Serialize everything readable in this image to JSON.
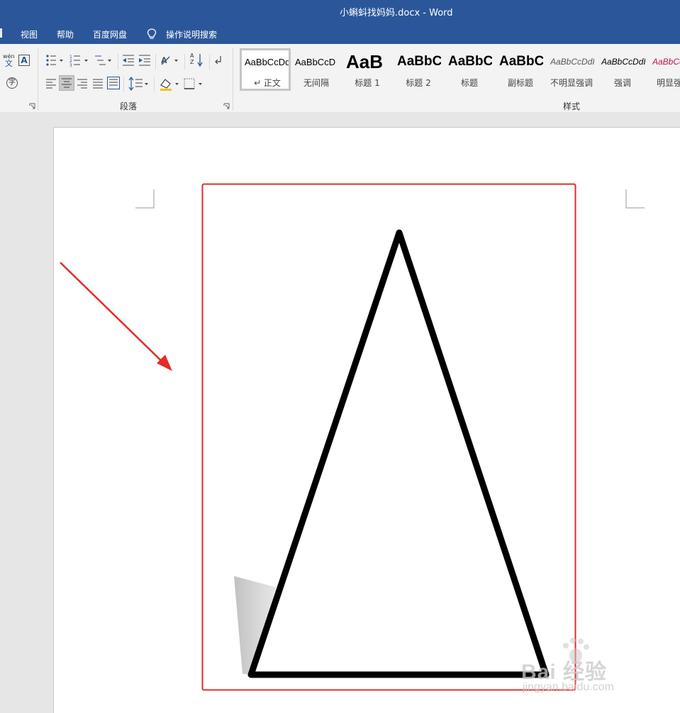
{
  "window": {
    "title": "小蝌蚪找妈妈.docx  -  Word"
  },
  "menu": {
    "items": [
      "视图",
      "帮助",
      "百度网盘"
    ],
    "tell_me": "操作说明搜索"
  },
  "ribbon": {
    "paragraph_group_label": "段落",
    "styles_group_label": "样式",
    "phonetic_glyph": "wén",
    "phonetic_char": "文",
    "encircle_char": "字",
    "sort_label": "A Z",
    "text_box_char": "A"
  },
  "styles": [
    {
      "preview": "AaBbCcDd",
      "name": "↵ 正文",
      "selected": true
    },
    {
      "preview": "AaBbCcD",
      "name": "无间隔"
    },
    {
      "preview": "AaB",
      "name": "标题 1"
    },
    {
      "preview": "AaBbC",
      "name": "标题 2"
    },
    {
      "preview": "AaBbC",
      "name": "标题"
    },
    {
      "preview": "AaBbC",
      "name": "副标题"
    },
    {
      "preview": "AaBbCcDdI",
      "name": "不明显强调"
    },
    {
      "preview": "AaBbCcDdI",
      "name": "强调"
    },
    {
      "preview": "AaBbCc",
      "name": "明显强"
    }
  ],
  "watermark": {
    "brand": "Bai 经验",
    "url": "jingyan.baidu.com"
  },
  "colors": {
    "title_bar": "#2b579a",
    "annotation_red": "#e52b24",
    "intense_emphasis": "#b8174c"
  }
}
